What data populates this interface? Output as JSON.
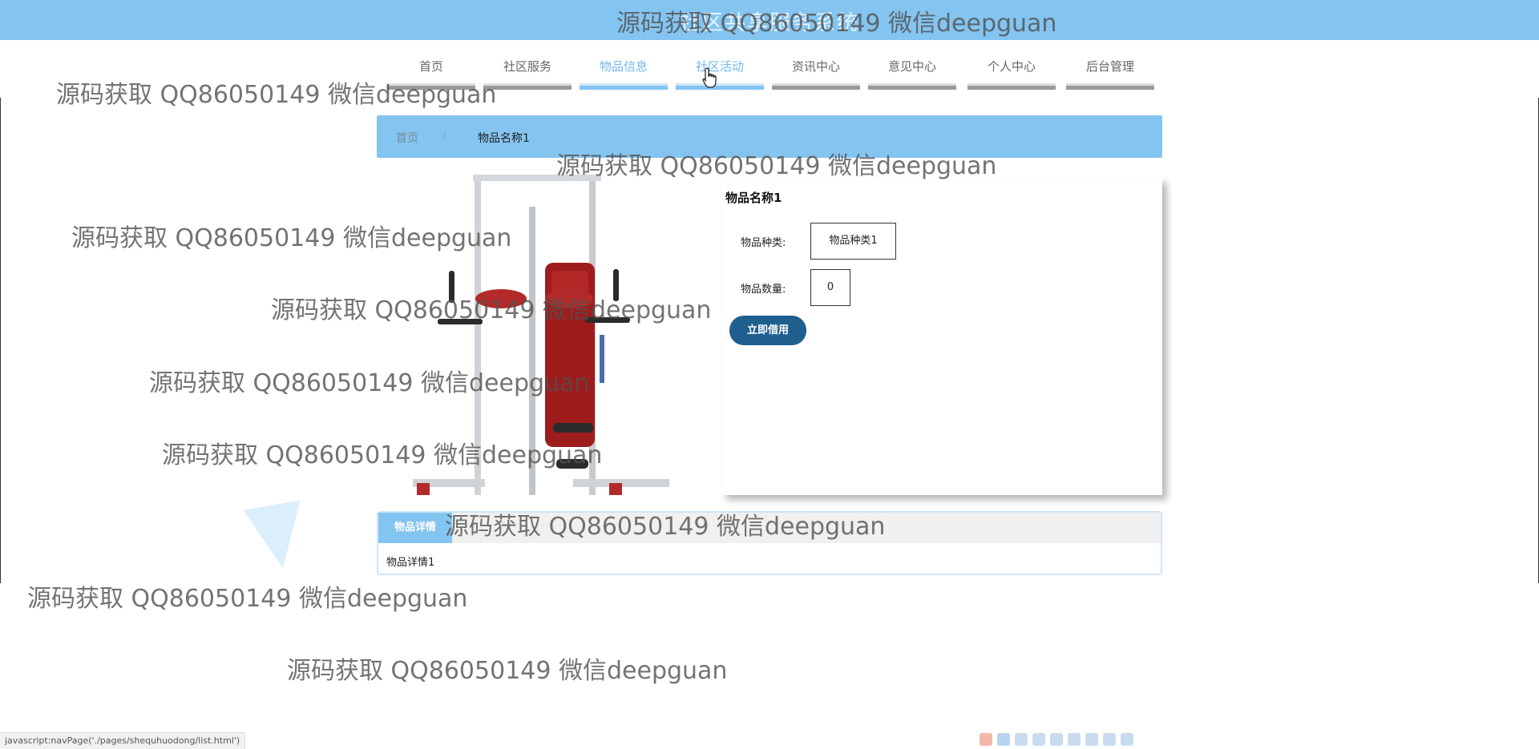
{
  "site": {
    "title": "社区共享服务系统"
  },
  "nav": {
    "items": [
      {
        "label": "首页"
      },
      {
        "label": "社区服务"
      },
      {
        "label": "物品信息"
      },
      {
        "label": "社区活动"
      },
      {
        "label": "资讯中心"
      },
      {
        "label": "意见中心"
      },
      {
        "label": "个人中心"
      },
      {
        "label": "后台管理"
      }
    ],
    "active": "物品信息",
    "hovered": "社区活动"
  },
  "breadcrumb": {
    "home": "首页",
    "separator": "/",
    "current": "物品名称1"
  },
  "product": {
    "title": "物品名称1",
    "category_label": "物品种类:",
    "category_value": "物品种类1",
    "quantity_label": "物品数量:",
    "quantity_value": "0",
    "borrow_button": "立即借用"
  },
  "details": {
    "tab_label": "物品详情",
    "content": "物品详情1"
  },
  "watermark": {
    "text": "源码获取 QQ86050149 微信deepguan"
  },
  "status_bar": {
    "text": "javascript:navPage('./pages/shequhuodong/list.html')"
  },
  "colors": {
    "primary": "#84c4f0",
    "button": "#1f5f8e",
    "nav_bar": "#9a9a9a"
  },
  "icons": {
    "cursor": "hand-pointer-icon",
    "ime_toolbar": [
      "sogou-logo-icon",
      "chinese-mode-icon",
      "moon-icon",
      "punctuation-icon",
      "keyboard-icon",
      "voice-icon",
      "grid-icon",
      "shirt-icon",
      "settings-icon"
    ]
  }
}
